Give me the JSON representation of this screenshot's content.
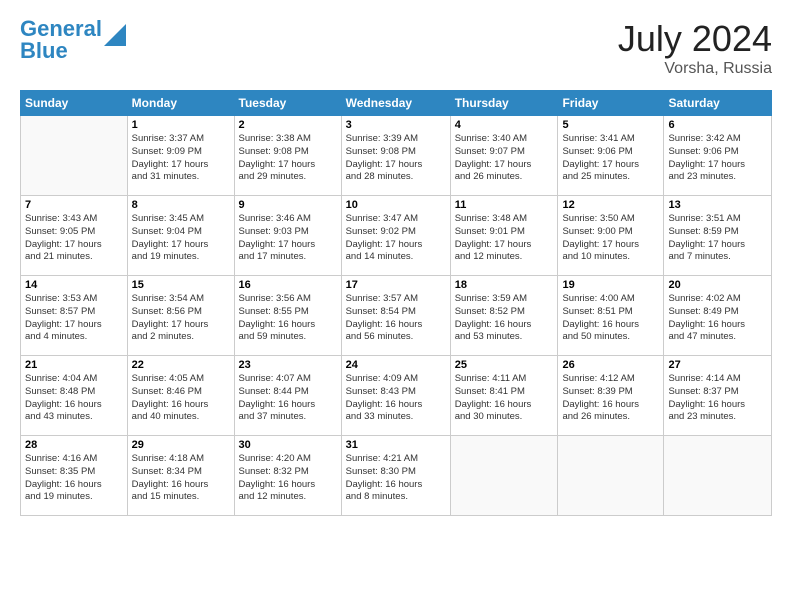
{
  "header": {
    "logo_line1": "General",
    "logo_line2": "Blue",
    "month_year": "July 2024",
    "location": "Vorsha, Russia"
  },
  "weekdays": [
    "Sunday",
    "Monday",
    "Tuesday",
    "Wednesday",
    "Thursday",
    "Friday",
    "Saturday"
  ],
  "weeks": [
    [
      {
        "day": "",
        "info": ""
      },
      {
        "day": "1",
        "info": "Sunrise: 3:37 AM\nSunset: 9:09 PM\nDaylight: 17 hours\nand 31 minutes."
      },
      {
        "day": "2",
        "info": "Sunrise: 3:38 AM\nSunset: 9:08 PM\nDaylight: 17 hours\nand 29 minutes."
      },
      {
        "day": "3",
        "info": "Sunrise: 3:39 AM\nSunset: 9:08 PM\nDaylight: 17 hours\nand 28 minutes."
      },
      {
        "day": "4",
        "info": "Sunrise: 3:40 AM\nSunset: 9:07 PM\nDaylight: 17 hours\nand 26 minutes."
      },
      {
        "day": "5",
        "info": "Sunrise: 3:41 AM\nSunset: 9:06 PM\nDaylight: 17 hours\nand 25 minutes."
      },
      {
        "day": "6",
        "info": "Sunrise: 3:42 AM\nSunset: 9:06 PM\nDaylight: 17 hours\nand 23 minutes."
      }
    ],
    [
      {
        "day": "7",
        "info": "Sunrise: 3:43 AM\nSunset: 9:05 PM\nDaylight: 17 hours\nand 21 minutes."
      },
      {
        "day": "8",
        "info": "Sunrise: 3:45 AM\nSunset: 9:04 PM\nDaylight: 17 hours\nand 19 minutes."
      },
      {
        "day": "9",
        "info": "Sunrise: 3:46 AM\nSunset: 9:03 PM\nDaylight: 17 hours\nand 17 minutes."
      },
      {
        "day": "10",
        "info": "Sunrise: 3:47 AM\nSunset: 9:02 PM\nDaylight: 17 hours\nand 14 minutes."
      },
      {
        "day": "11",
        "info": "Sunrise: 3:48 AM\nSunset: 9:01 PM\nDaylight: 17 hours\nand 12 minutes."
      },
      {
        "day": "12",
        "info": "Sunrise: 3:50 AM\nSunset: 9:00 PM\nDaylight: 17 hours\nand 10 minutes."
      },
      {
        "day": "13",
        "info": "Sunrise: 3:51 AM\nSunset: 8:59 PM\nDaylight: 17 hours\nand 7 minutes."
      }
    ],
    [
      {
        "day": "14",
        "info": "Sunrise: 3:53 AM\nSunset: 8:57 PM\nDaylight: 17 hours\nand 4 minutes."
      },
      {
        "day": "15",
        "info": "Sunrise: 3:54 AM\nSunset: 8:56 PM\nDaylight: 17 hours\nand 2 minutes."
      },
      {
        "day": "16",
        "info": "Sunrise: 3:56 AM\nSunset: 8:55 PM\nDaylight: 16 hours\nand 59 minutes."
      },
      {
        "day": "17",
        "info": "Sunrise: 3:57 AM\nSunset: 8:54 PM\nDaylight: 16 hours\nand 56 minutes."
      },
      {
        "day": "18",
        "info": "Sunrise: 3:59 AM\nSunset: 8:52 PM\nDaylight: 16 hours\nand 53 minutes."
      },
      {
        "day": "19",
        "info": "Sunrise: 4:00 AM\nSunset: 8:51 PM\nDaylight: 16 hours\nand 50 minutes."
      },
      {
        "day": "20",
        "info": "Sunrise: 4:02 AM\nSunset: 8:49 PM\nDaylight: 16 hours\nand 47 minutes."
      }
    ],
    [
      {
        "day": "21",
        "info": "Sunrise: 4:04 AM\nSunset: 8:48 PM\nDaylight: 16 hours\nand 43 minutes."
      },
      {
        "day": "22",
        "info": "Sunrise: 4:05 AM\nSunset: 8:46 PM\nDaylight: 16 hours\nand 40 minutes."
      },
      {
        "day": "23",
        "info": "Sunrise: 4:07 AM\nSunset: 8:44 PM\nDaylight: 16 hours\nand 37 minutes."
      },
      {
        "day": "24",
        "info": "Sunrise: 4:09 AM\nSunset: 8:43 PM\nDaylight: 16 hours\nand 33 minutes."
      },
      {
        "day": "25",
        "info": "Sunrise: 4:11 AM\nSunset: 8:41 PM\nDaylight: 16 hours\nand 30 minutes."
      },
      {
        "day": "26",
        "info": "Sunrise: 4:12 AM\nSunset: 8:39 PM\nDaylight: 16 hours\nand 26 minutes."
      },
      {
        "day": "27",
        "info": "Sunrise: 4:14 AM\nSunset: 8:37 PM\nDaylight: 16 hours\nand 23 minutes."
      }
    ],
    [
      {
        "day": "28",
        "info": "Sunrise: 4:16 AM\nSunset: 8:35 PM\nDaylight: 16 hours\nand 19 minutes."
      },
      {
        "day": "29",
        "info": "Sunrise: 4:18 AM\nSunset: 8:34 PM\nDaylight: 16 hours\nand 15 minutes."
      },
      {
        "day": "30",
        "info": "Sunrise: 4:20 AM\nSunset: 8:32 PM\nDaylight: 16 hours\nand 12 minutes."
      },
      {
        "day": "31",
        "info": "Sunrise: 4:21 AM\nSunset: 8:30 PM\nDaylight: 16 hours\nand 8 minutes."
      },
      {
        "day": "",
        "info": ""
      },
      {
        "day": "",
        "info": ""
      },
      {
        "day": "",
        "info": ""
      }
    ]
  ]
}
